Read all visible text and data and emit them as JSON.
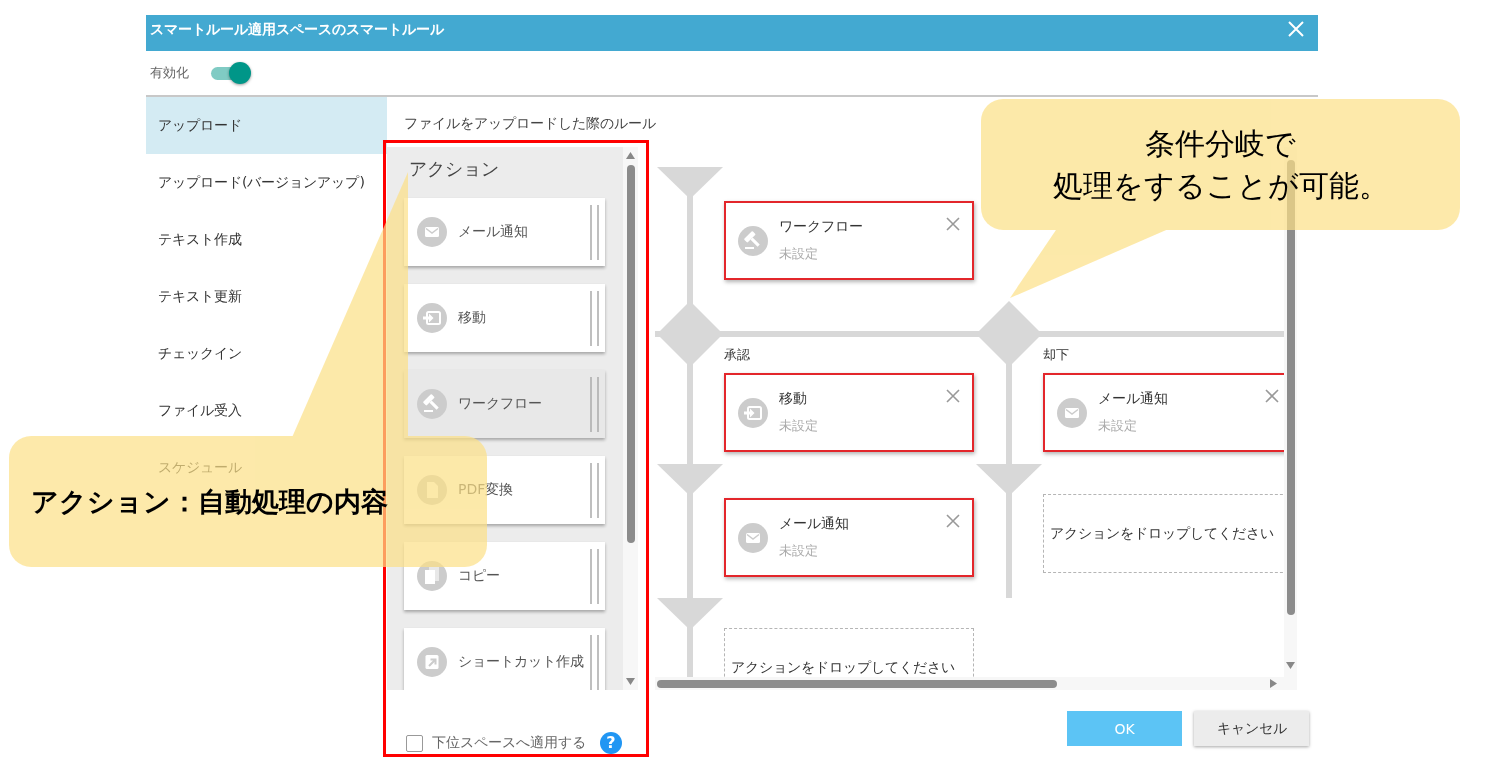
{
  "dialog": {
    "title": "スマートルール適用スペースのスマートルール"
  },
  "enabled": {
    "label": "有効化",
    "on": true
  },
  "sidebar": {
    "items": [
      {
        "label": "アップロード",
        "selected": true
      },
      {
        "label": "アップロード(バージョンアップ)",
        "selected": false
      },
      {
        "label": "テキスト作成",
        "selected": false
      },
      {
        "label": "テキスト更新",
        "selected": false
      },
      {
        "label": "チェックイン",
        "selected": false
      },
      {
        "label": "ファイル受入",
        "selected": false
      },
      {
        "label": "スケジュール",
        "selected": false
      }
    ]
  },
  "rule": {
    "heading": "ファイルをアップロードした際のルール"
  },
  "actions": {
    "title": "アクション",
    "items": [
      {
        "kind": "mail",
        "label": "メール通知",
        "selected": false
      },
      {
        "kind": "move",
        "label": "移動",
        "selected": false
      },
      {
        "kind": "workflow",
        "label": "ワークフロー",
        "selected": true
      },
      {
        "kind": "pdf",
        "label": "PDF変換",
        "selected": false
      },
      {
        "kind": "copy",
        "label": "コピー",
        "selected": false
      },
      {
        "kind": "shortcut",
        "label": "ショートカット作成",
        "selected": false
      }
    ]
  },
  "apply_to_subspaces": {
    "label": "下位スペースへ適用する",
    "checked": false,
    "help": "?"
  },
  "flow": {
    "steps": [
      {
        "kind": "workflow",
        "title": "ワークフロー",
        "status": "未設定"
      },
      {
        "kind": "branch",
        "branches": [
          {
            "label": "承認",
            "steps": [
              {
                "kind": "move",
                "title": "移動",
                "status": "未設定"
              },
              {
                "kind": "mail",
                "title": "メール通知",
                "status": "未設定"
              },
              {
                "kind": "dropzone",
                "text": "アクションをドロップしてください"
              }
            ]
          },
          {
            "label": "却下",
            "steps": [
              {
                "kind": "mail",
                "title": "メール通知",
                "status": "未設定"
              },
              {
                "kind": "dropzone",
                "text": "アクションをドロップしてください"
              }
            ]
          }
        ]
      }
    ]
  },
  "buttons": [
    {
      "label": "OK",
      "kind": "primary"
    },
    {
      "label": "キャンセル",
      "kind": "secondary"
    }
  ],
  "callouts": [
    {
      "lines": [
        "条件分岐で",
        "処理をすることが可能。"
      ]
    },
    {
      "lines": [
        "アクション：自動処理の内容"
      ]
    }
  ]
}
